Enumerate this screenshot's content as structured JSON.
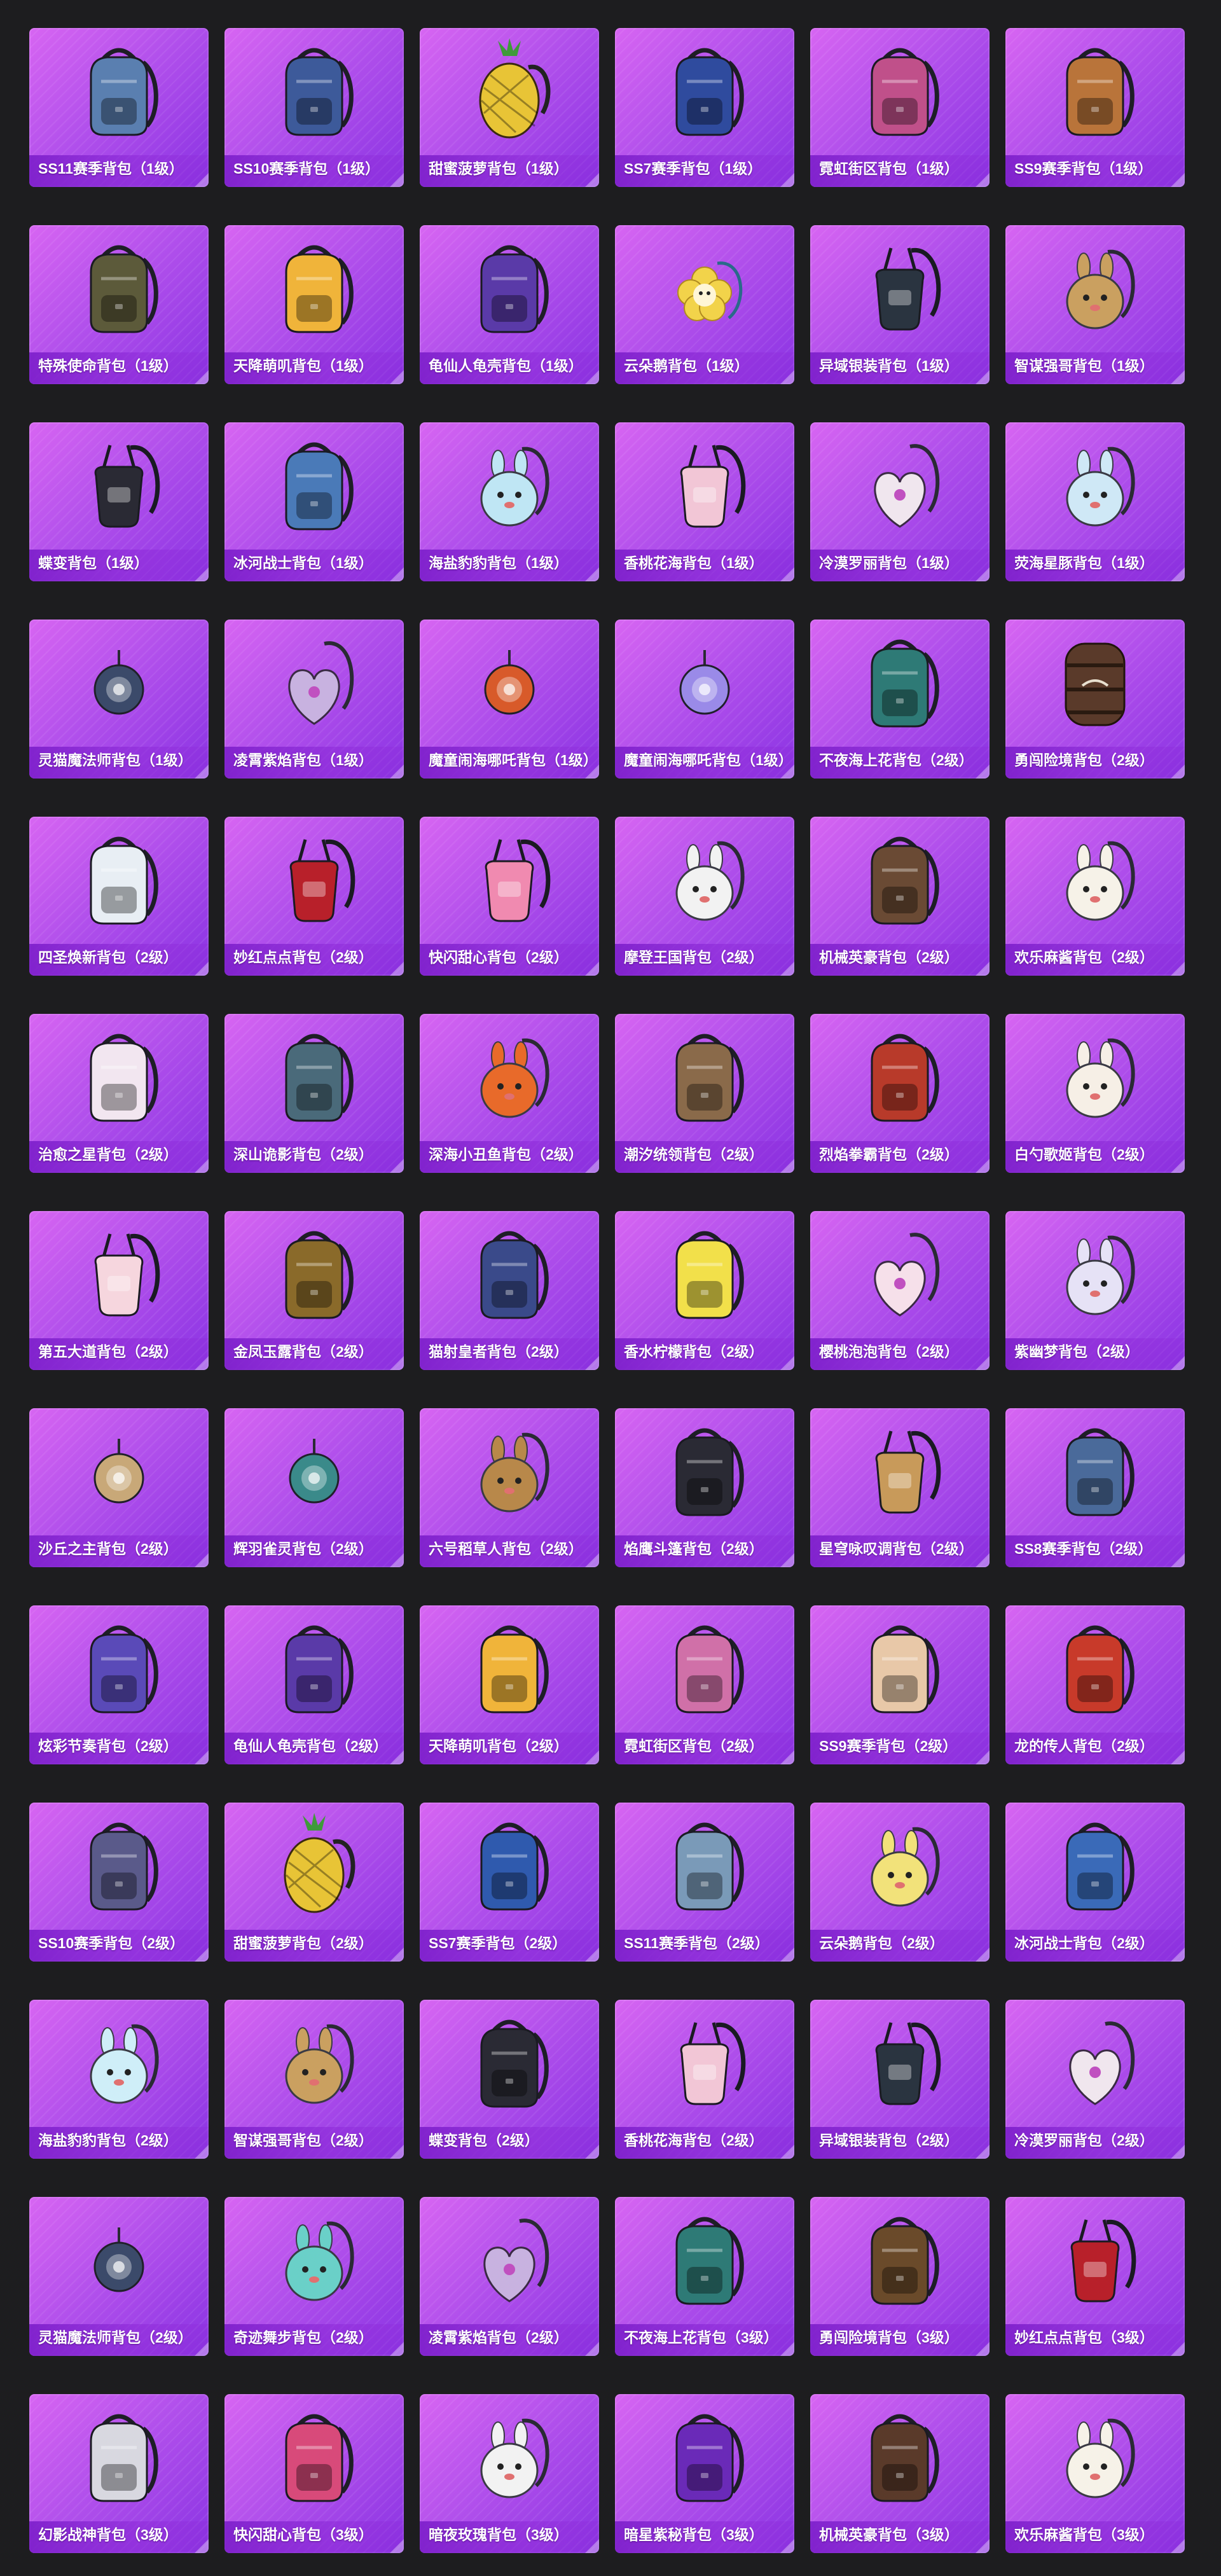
{
  "items": [
    {
      "label": "SS11赛季背包（1级）",
      "icon": "backpack-icon",
      "color": "#5a7fb0"
    },
    {
      "label": "SS10赛季背包（1级）",
      "icon": "backpack-icon",
      "color": "#3d5a9a"
    },
    {
      "label": "甜蜜菠萝背包（1级）",
      "icon": "pineapple-backpack-icon",
      "color": "#e8c436"
    },
    {
      "label": "SS7赛季背包（1级）",
      "icon": "backpack-icon",
      "color": "#2f4b9e"
    },
    {
      "label": "霓虹街区背包（1级）",
      "icon": "backpack-icon",
      "color": "#c0508a"
    },
    {
      "label": "SS9赛季背包（1级）",
      "icon": "backpack-icon",
      "color": "#b9743a"
    },
    {
      "label": "特殊使命背包（1级）",
      "icon": "backpack-icon",
      "color": "#5c5a3a"
    },
    {
      "label": "天降萌叽背包（1级）",
      "icon": "backpack-icon",
      "color": "#f0b43a"
    },
    {
      "label": "龟仙人龟壳背包（1级）",
      "icon": "backpack-icon",
      "color": "#5a3aa8"
    },
    {
      "label": "云朵鹅背包（1级）",
      "icon": "flower-pendant-icon",
      "color": "#f2d34a"
    },
    {
      "label": "异域银装背包（1级）",
      "icon": "pouch-icon",
      "color": "#2a3440"
    },
    {
      "label": "智谋强哥背包（1级）",
      "icon": "plush-pendant-icon",
      "color": "#caa060"
    },
    {
      "label": "蝶变背包（1级）",
      "icon": "pouch-icon",
      "color": "#2a2a34"
    },
    {
      "label": "冰河战士背包（1级）",
      "icon": "backpack-icon",
      "color": "#4a7ab8"
    },
    {
      "label": "海盐豹豹背包（1级）",
      "icon": "plush-pendant-icon",
      "color": "#bfe6f4"
    },
    {
      "label": "香桃花海背包（1级）",
      "icon": "pouch-icon",
      "color": "#f2c6d6"
    },
    {
      "label": "冷漠罗丽背包（1级）",
      "icon": "heart-pendant-icon",
      "color": "#f0e6ee"
    },
    {
      "label": "荧海星豚背包（1级）",
      "icon": "plush-pendant-icon",
      "color": "#cfe8f6"
    },
    {
      "label": "灵猫魔法师背包（1级）",
      "icon": "orb-pendant-icon",
      "color": "#3b4a6a"
    },
    {
      "label": "凌霄紫焰背包（1级）",
      "icon": "heart-pendant-icon",
      "color": "#c8b2e0"
    },
    {
      "label": "魔童闹海哪吒背包（1级）",
      "icon": "orb-pendant-icon",
      "color": "#d85a2a"
    },
    {
      "label": "魔童闹海哪吒背包（1级）",
      "icon": "orb-pendant-icon",
      "color": "#9a8ae8"
    },
    {
      "label": "不夜海上花背包（2级）",
      "icon": "backpack-icon",
      "color": "#2e7a76"
    },
    {
      "label": "勇闯险境背包（2级）",
      "icon": "barrel-backpack-icon",
      "color": "#5a3a2a"
    },
    {
      "label": "四圣焕新背包（2级）",
      "icon": "backpack-icon",
      "color": "#e8eef4"
    },
    {
      "label": "妙红点点背包（2级）",
      "icon": "pouch-icon",
      "color": "#b8202a"
    },
    {
      "label": "快闪甜心背包（2级）",
      "icon": "pouch-icon",
      "color": "#f08ab0"
    },
    {
      "label": "摩登王国背包（2级）",
      "icon": "plush-pendant-icon",
      "color": "#f2f2f2"
    },
    {
      "label": "机械英豪背包（2级）",
      "icon": "backpack-icon",
      "color": "#6a4a34"
    },
    {
      "label": "欢乐麻酱背包（2级）",
      "icon": "plush-pendant-icon",
      "color": "#f6f2e8"
    },
    {
      "label": "治愈之星背包（2级）",
      "icon": "backpack-icon",
      "color": "#f2e6f0"
    },
    {
      "label": "深山诡影背包（2级）",
      "icon": "backpack-icon",
      "color": "#4a6a7a"
    },
    {
      "label": "深海小丑鱼背包（2级）",
      "icon": "plush-pendant-icon",
      "color": "#e86a2a"
    },
    {
      "label": "潮汐统领背包（2级）",
      "icon": "backpack-icon",
      "color": "#8a6a4a"
    },
    {
      "label": "烈焰拳霸背包（2级）",
      "icon": "backpack-icon",
      "color": "#b83a2a"
    },
    {
      "label": "白勺歌姬背包（2级）",
      "icon": "plush-pendant-icon",
      "color": "#f6efe6"
    },
    {
      "label": "第五大道背包（2级）",
      "icon": "pouch-icon",
      "color": "#f6d6de"
    },
    {
      "label": "金凤玉露背包（2级）",
      "icon": "backpack-icon",
      "color": "#8a6a2a"
    },
    {
      "label": "猫射皇者背包（2级）",
      "icon": "backpack-icon",
      "color": "#3a4a8a"
    },
    {
      "label": "香水柠檬背包（2级）",
      "icon": "backpack-icon",
      "color": "#f2e04a"
    },
    {
      "label": "樱桃泡泡背包（2级）",
      "icon": "heart-pendant-icon",
      "color": "#f6e0ea"
    },
    {
      "label": "紫幽梦背包（2级）",
      "icon": "plush-pendant-icon",
      "color": "#e6e2f6"
    },
    {
      "label": "沙丘之主背包（2级）",
      "icon": "orb-pendant-icon",
      "color": "#c8a878"
    },
    {
      "label": "辉羽雀灵背包（2级）",
      "icon": "orb-pendant-icon",
      "color": "#3a8a8a"
    },
    {
      "label": "六号稻草人背包（2级）",
      "icon": "plush-pendant-icon",
      "color": "#b8884a"
    },
    {
      "label": "焰鹰斗篷背包（2级）",
      "icon": "backpack-icon",
      "color": "#2a2a34"
    },
    {
      "label": "星穹咏叹调背包（2级）",
      "icon": "pouch-icon",
      "color": "#c89a5a"
    },
    {
      "label": "SS8赛季背包（2级）",
      "icon": "backpack-icon",
      "color": "#4a6a9a"
    },
    {
      "label": "炫彩节奏背包（2级）",
      "icon": "backpack-icon",
      "color": "#5a4ab8"
    },
    {
      "label": "龟仙人龟壳背包（2级）",
      "icon": "backpack-icon",
      "color": "#5a3aa8"
    },
    {
      "label": "天降萌叽背包（2级）",
      "icon": "backpack-icon",
      "color": "#f0b43a"
    },
    {
      "label": "霓虹街区背包（2级）",
      "icon": "backpack-icon",
      "color": "#d070a8"
    },
    {
      "label": "SS9赛季背包（2级）",
      "icon": "backpack-icon",
      "color": "#e8c8a8"
    },
    {
      "label": "龙的传人背包（2级）",
      "icon": "backpack-icon",
      "color": "#c83a2a"
    },
    {
      "label": "SS10赛季背包（2级）",
      "icon": "backpack-icon",
      "color": "#5a5a8a"
    },
    {
      "label": "甜蜜菠萝背包（2级）",
      "icon": "pineapple-backpack-icon",
      "color": "#e8c436"
    },
    {
      "label": "SS7赛季背包（2级）",
      "icon": "backpack-icon",
      "color": "#2f5aae"
    },
    {
      "label": "SS11赛季背包（2级）",
      "icon": "backpack-icon",
      "color": "#7a9ab8"
    },
    {
      "label": "云朵鹅背包（2级）",
      "icon": "plush-pendant-icon",
      "color": "#f2e27a"
    },
    {
      "label": "冰河战士背包（2级）",
      "icon": "backpack-icon",
      "color": "#3a6ab8"
    },
    {
      "label": "海盐豹豹背包（2级）",
      "icon": "plush-pendant-icon",
      "color": "#cfeef8"
    },
    {
      "label": "智谋强哥背包（2级）",
      "icon": "plush-pendant-icon",
      "color": "#caa060"
    },
    {
      "label": "蝶变背包（2级）",
      "icon": "backpack-icon",
      "color": "#2a2a34"
    },
    {
      "label": "香桃花海背包（2级）",
      "icon": "pouch-icon",
      "color": "#f2c6d6"
    },
    {
      "label": "异域银装背包（2级）",
      "icon": "pouch-icon",
      "color": "#2a3440"
    },
    {
      "label": "冷漠罗丽背包（2级）",
      "icon": "heart-pendant-icon",
      "color": "#f0e6ee"
    },
    {
      "label": "灵猫魔法师背包（2级）",
      "icon": "orb-pendant-icon",
      "color": "#3b4a6a"
    },
    {
      "label": "奇迹舞步背包（2级）",
      "icon": "plush-pendant-icon",
      "color": "#6ad0c8"
    },
    {
      "label": "凌霄紫焰背包（2级）",
      "icon": "heart-pendant-icon",
      "color": "#c8b2e0"
    },
    {
      "label": "不夜海上花背包（3级）",
      "icon": "backpack-icon",
      "color": "#2e7a76"
    },
    {
      "label": "勇闯险境背包（3级）",
      "icon": "backpack-icon",
      "color": "#6a4a2a"
    },
    {
      "label": "妙红点点背包（3级）",
      "icon": "pouch-icon",
      "color": "#b8202a"
    },
    {
      "label": "幻影战神背包（3级）",
      "icon": "backpack-icon",
      "color": "#d8d8e0"
    },
    {
      "label": "快闪甜心背包（3级）",
      "icon": "backpack-icon",
      "color": "#d84a7a"
    },
    {
      "label": "暗夜玫瑰背包（3级）",
      "icon": "plush-pendant-icon",
      "color": "#f2f2f2"
    },
    {
      "label": "暗星紫秘背包（3级）",
      "icon": "backpack-icon",
      "color": "#6a2ab8"
    },
    {
      "label": "机械英豪背包（3级）",
      "icon": "backpack-icon",
      "color": "#5a3a2a"
    },
    {
      "label": "欢乐麻酱背包（3级）",
      "icon": "plush-pendant-icon",
      "color": "#f6f2e8"
    }
  ]
}
